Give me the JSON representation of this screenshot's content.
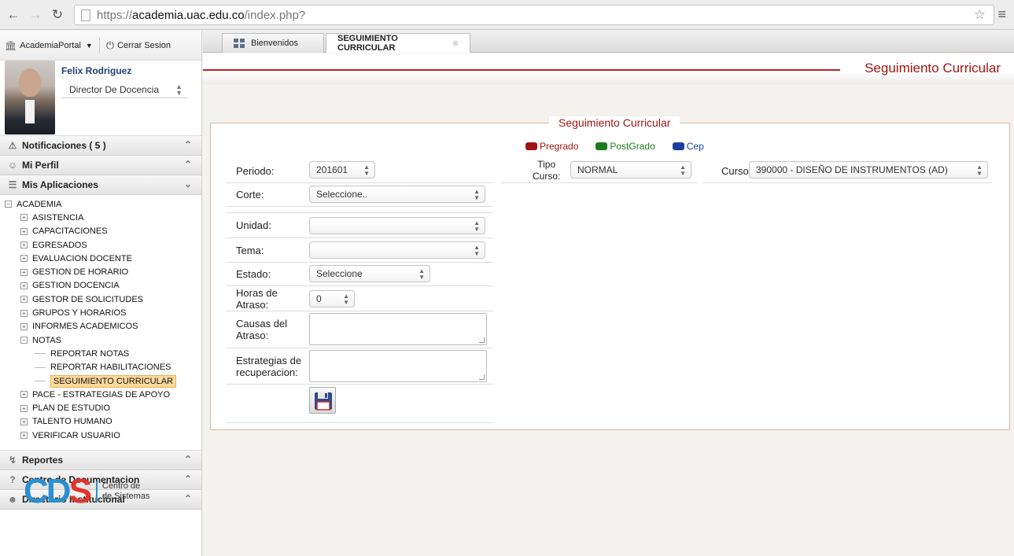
{
  "browser": {
    "url_prefix": "https://",
    "url_host": "academia.uac.edu.co",
    "url_path": "/index.php?"
  },
  "sidebar": {
    "portal_label": "AcademiaPortal",
    "logout_label": "Cerrar Sesion",
    "user_name": "Felix Rodriguez",
    "user_role": "Director De Docencia",
    "sections": {
      "notifications": "Notificaciones ( 5 )",
      "profile": "Mi Perfil",
      "apps": "Mis Aplicaciones",
      "reports": "Reportes",
      "docs": "Centro de Documentacion",
      "directory": "Directorio Institucional"
    },
    "tree": {
      "root": "ACADEMIA",
      "items": [
        "ASISTENCIA",
        "CAPACITACIONES",
        "EGRESADOS",
        "EVALUACION DOCENTE",
        "GESTION DE HORARIO",
        "GESTION DOCENCIA",
        "GESTOR DE SOLICITUDES",
        "GRUPOS Y HORARIOS",
        "INFORMES ACADEMICOS",
        "NOTAS"
      ],
      "notas_children": [
        "REPORTAR NOTAS",
        "REPORTAR HABILITACIONES",
        "SEGUIMIENTO CURRICULAR"
      ],
      "items_after": [
        "PACE - ESTRATEGIAS DE APOYO",
        "PLAN DE ESTUDIO",
        "TALENTO HUMANO",
        "VERIFICAR USUARIO"
      ]
    },
    "logo": {
      "letters": "CDS",
      "line1": "Centro de",
      "line2": "de Sistemas"
    }
  },
  "tabs": {
    "welcome": "Bienvenidos",
    "active": "SEGUIMIENTO CURRICULAR"
  },
  "header": {
    "title": "Seguimiento  Curricular"
  },
  "form": {
    "legend": "Seguimiento Curricular",
    "legend_items": [
      {
        "label": "Pregrado",
        "color": "#a31212"
      },
      {
        "label": "PostGrado",
        "color": "#1c7a1c"
      },
      {
        "label": "Cep",
        "color": "#1a3fa0"
      }
    ],
    "periodo_label": "Periodo:",
    "periodo_value": "201601",
    "tipo_curso_label_1": "Tipo",
    "tipo_curso_label_2": "Curso:",
    "tipo_curso_value": "NORMAL",
    "curso_label": "Curso:",
    "curso_value": "390000 - DISEÑO DE INSTRUMENTOS (AD)",
    "corte_label": "Corte:",
    "corte_value": "Seleccione..",
    "unidad_label": "Unidad:",
    "unidad_value": "",
    "tema_label": "Tema:",
    "tema_value": "",
    "estado_label": "Estado:",
    "estado_value": "Seleccione",
    "horas_label_1": "Horas de",
    "horas_label_2": "Atraso:",
    "horas_value": "0",
    "causas_label_1": "Causas del",
    "causas_label_2": "Atraso:",
    "estrategias_label_1": "Estrategias de",
    "estrategias_label_2": "recuperacion:"
  }
}
